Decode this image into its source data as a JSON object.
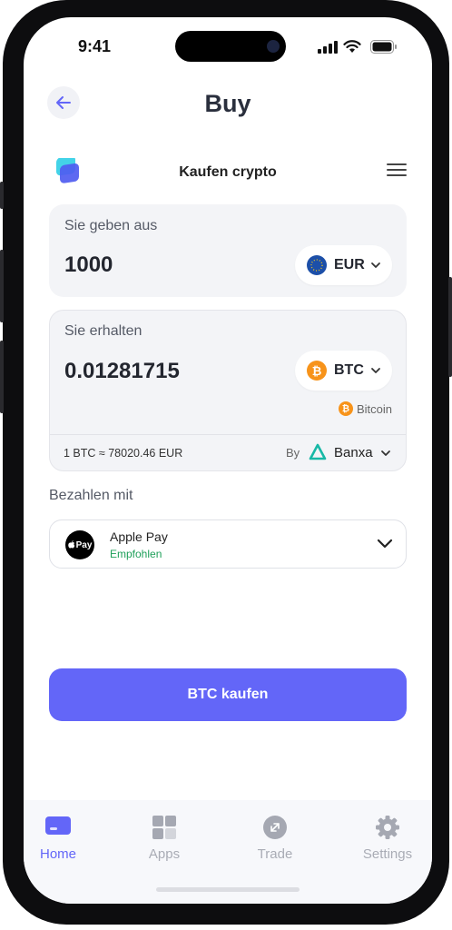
{
  "status_bar": {
    "time": "9:41"
  },
  "header": {
    "title": "Buy"
  },
  "widget": {
    "title": "Kaufen crypto"
  },
  "give": {
    "label": "Sie geben aus",
    "amount": "1000",
    "currency": "EUR"
  },
  "receive": {
    "label": "Sie erhalten",
    "amount": "0.01281715",
    "currency": "BTC",
    "coin_name": "Bitcoin",
    "rate": "1 BTC ≈ 78020.46 EUR",
    "provider_prefix": "By",
    "provider": "Banxa"
  },
  "payment": {
    "label": "Bezahlen mit",
    "method": "Apple Pay",
    "badge_text": "Pay",
    "note": "Empfohlen"
  },
  "action": {
    "button_label": "BTC kaufen"
  },
  "tabs": [
    {
      "label": "Home",
      "icon": "card-icon",
      "active": true
    },
    {
      "label": "Apps",
      "icon": "apps-grid-icon",
      "active": false
    },
    {
      "label": "Trade",
      "icon": "trade-icon",
      "active": false
    },
    {
      "label": "Settings",
      "icon": "gear-icon",
      "active": false
    }
  ],
  "colors": {
    "accent": "#6366f8",
    "bitcoin": "#f7931a",
    "eur": "#1c4fa8",
    "success": "#1fa05a",
    "banxa": "#17b8a6"
  }
}
